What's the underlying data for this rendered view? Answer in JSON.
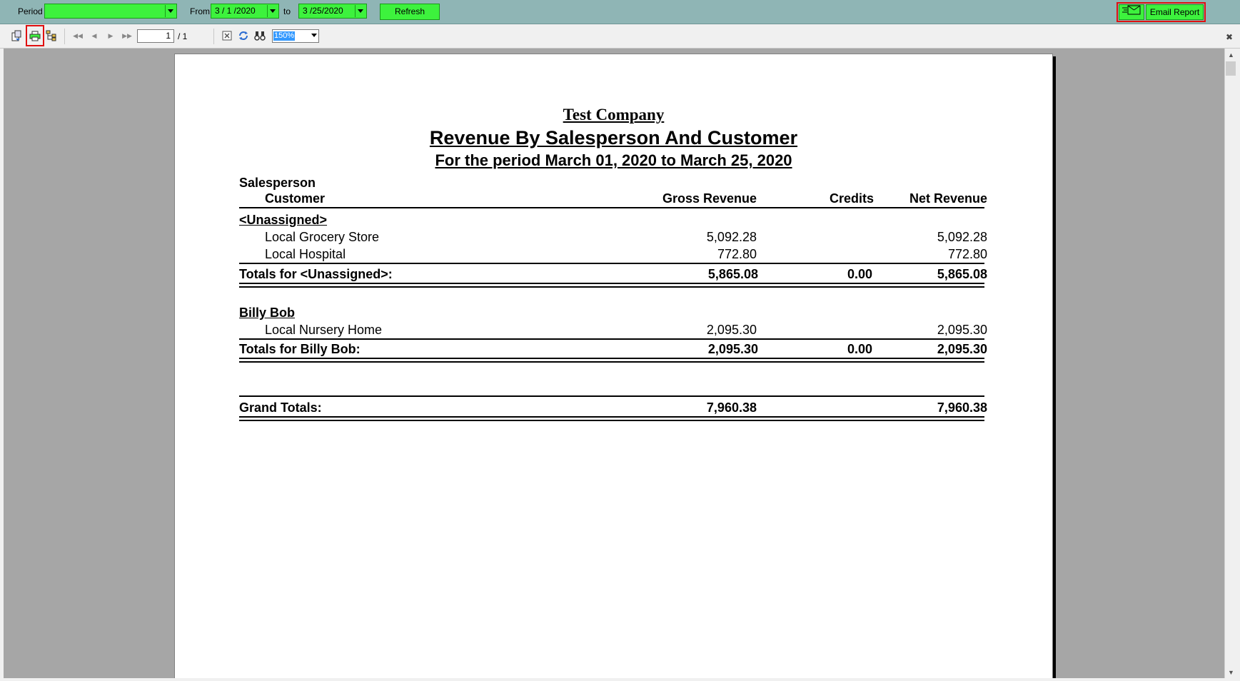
{
  "filter_bar": {
    "period_label": "Period",
    "period_value": "",
    "from_label": "From",
    "from_value": "3 / 1 /2020",
    "to_label": "to",
    "to_value": "3 /25/2020",
    "refresh_label": "Refresh",
    "email_label": "Email Report"
  },
  "viewer_toolbar": {
    "page_current": "1",
    "page_total": "/ 1",
    "zoom_value": "150%"
  },
  "report": {
    "company": "Test Company",
    "title": "Revenue By Salesperson And Customer",
    "subtitle": "For the period March 01, 2020 to March 25, 2020",
    "columns": {
      "salesperson": "Salesperson",
      "customer": "Customer",
      "gross": "Gross Revenue",
      "credits": "Credits",
      "net": "Net Revenue"
    },
    "groups": [
      {
        "name": "<Unassigned>",
        "rows": [
          {
            "customer": "Local Grocery Store",
            "gross": "5,092.28",
            "net": "5,092.28"
          },
          {
            "customer": "Local Hospital",
            "gross": "772.80",
            "net": "772.80"
          }
        ],
        "total_label": "Totals for <Unassigned>:",
        "total_gross": "5,865.08",
        "total_credits": "0.00",
        "total_net": "5,865.08"
      },
      {
        "name": "Billy Bob",
        "rows": [
          {
            "customer": "Local Nursery Home",
            "gross": "2,095.30",
            "net": "2,095.30"
          }
        ],
        "total_label": "Totals for Billy Bob:",
        "total_gross": "2,095.30",
        "total_credits": "0.00",
        "total_net": "2,095.30"
      }
    ],
    "grand_total_label": "Grand Totals:",
    "grand_total_gross": "7,960.38",
    "grand_total_net": "7,960.38"
  }
}
